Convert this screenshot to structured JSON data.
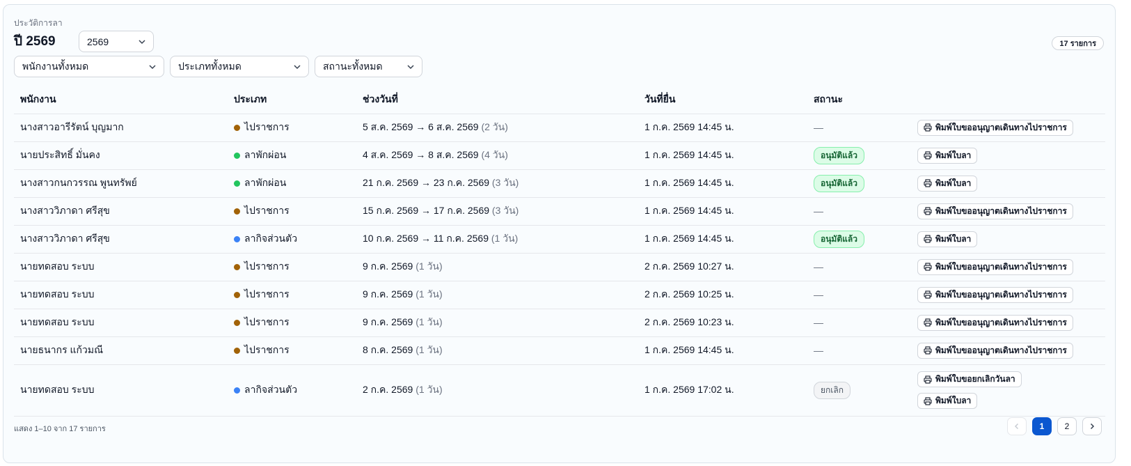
{
  "header": {
    "eyebrow": "ประวัติการลา",
    "title": "ปี 2569",
    "year_select_value": "2569",
    "count_badge": "17 รายการ"
  },
  "filters": {
    "employee": "พนักงานทั้งหมด",
    "type": "ประเภททั้งหมด",
    "status": "สถานะทั้งหมด"
  },
  "table": {
    "columns": [
      "พนักงาน",
      "ประเภท",
      "ช่วงวันที่",
      "วันที่ยื่น",
      "สถานะ",
      ""
    ],
    "rows": [
      {
        "employee": "นางสาวอารีรัตน์ บุญมาก",
        "type": "ไปราชการ",
        "type_color": "#a16207",
        "range": "5 ส.ค. 2569 → 6 ส.ค. 2569",
        "days": "(2 วัน)",
        "submitted": "1 ก.ค. 2569 14:45 น.",
        "status": "—",
        "status_kind": "none",
        "actions": [
          "พิมพ์ใบขออนุญาตเดินทางไปราชการ"
        ]
      },
      {
        "employee": "นายประสิทธิ์ มั่นคง",
        "type": "ลาพักผ่อน",
        "type_color": "#22c55e",
        "range": "4 ส.ค. 2569 → 8 ส.ค. 2569",
        "days": "(4 วัน)",
        "submitted": "1 ก.ค. 2569 14:45 น.",
        "status": "อนุมัติแล้ว",
        "status_kind": "approved",
        "actions": [
          "พิมพ์ใบลา"
        ]
      },
      {
        "employee": "นางสาวกนกวรรณ พูนทรัพย์",
        "type": "ลาพักผ่อน",
        "type_color": "#22c55e",
        "range": "21 ก.ค. 2569 → 23 ก.ค. 2569",
        "days": "(3 วัน)",
        "submitted": "1 ก.ค. 2569 14:45 น.",
        "status": "อนุมัติแล้ว",
        "status_kind": "approved",
        "actions": [
          "พิมพ์ใบลา"
        ]
      },
      {
        "employee": "นางสาววิภาดา ศรีสุข",
        "type": "ไปราชการ",
        "type_color": "#a16207",
        "range": "15 ก.ค. 2569 → 17 ก.ค. 2569",
        "days": "(3 วัน)",
        "submitted": "1 ก.ค. 2569 14:45 น.",
        "status": "—",
        "status_kind": "none",
        "actions": [
          "พิมพ์ใบขออนุญาตเดินทางไปราชการ"
        ]
      },
      {
        "employee": "นางสาววิภาดา ศรีสุข",
        "type": "ลากิจส่วนตัว",
        "type_color": "#3b82f6",
        "range": "10 ก.ค. 2569 → 11 ก.ค. 2569",
        "days": "(1 วัน)",
        "submitted": "1 ก.ค. 2569 14:45 น.",
        "status": "อนุมัติแล้ว",
        "status_kind": "approved",
        "actions": [
          "พิมพ์ใบลา"
        ]
      },
      {
        "employee": "นายทดสอบ ระบบ",
        "type": "ไปราชการ",
        "type_color": "#a16207",
        "range": "9 ก.ค. 2569",
        "days": "(1 วัน)",
        "submitted": "2 ก.ค. 2569 10:27 น.",
        "status": "—",
        "status_kind": "none",
        "actions": [
          "พิมพ์ใบขออนุญาตเดินทางไปราชการ"
        ]
      },
      {
        "employee": "นายทดสอบ ระบบ",
        "type": "ไปราชการ",
        "type_color": "#a16207",
        "range": "9 ก.ค. 2569",
        "days": "(1 วัน)",
        "submitted": "2 ก.ค. 2569 10:25 น.",
        "status": "—",
        "status_kind": "none",
        "actions": [
          "พิมพ์ใบขออนุญาตเดินทางไปราชการ"
        ]
      },
      {
        "employee": "นายทดสอบ ระบบ",
        "type": "ไปราชการ",
        "type_color": "#a16207",
        "range": "9 ก.ค. 2569",
        "days": "(1 วัน)",
        "submitted": "2 ก.ค. 2569 10:23 น.",
        "status": "—",
        "status_kind": "none",
        "actions": [
          "พิมพ์ใบขออนุญาตเดินทางไปราชการ"
        ]
      },
      {
        "employee": "นายธนากร แก้วมณี",
        "type": "ไปราชการ",
        "type_color": "#a16207",
        "range": "8 ก.ค. 2569",
        "days": "(1 วัน)",
        "submitted": "1 ก.ค. 2569 14:45 น.",
        "status": "—",
        "status_kind": "none",
        "actions": [
          "พิมพ์ใบขออนุญาตเดินทางไปราชการ"
        ]
      },
      {
        "employee": "นายทดสอบ ระบบ",
        "type": "ลากิจส่วนตัว",
        "type_color": "#3b82f6",
        "range": "2 ก.ค. 2569",
        "days": "(1 วัน)",
        "submitted": "1 ก.ค. 2569 17:02 น.",
        "status": "ยกเลิก",
        "status_kind": "cancelled",
        "actions": [
          "พิมพ์ใบขอยกเลิกวันลา",
          "พิมพ์ใบลา"
        ]
      }
    ]
  },
  "footer": {
    "summary": "แสดง 1–10 จาก 17 รายการ",
    "pages": [
      "1",
      "2"
    ],
    "current_page": "1",
    "prev_icon": "chevron-left-icon",
    "next_icon": "chevron-right-icon"
  }
}
